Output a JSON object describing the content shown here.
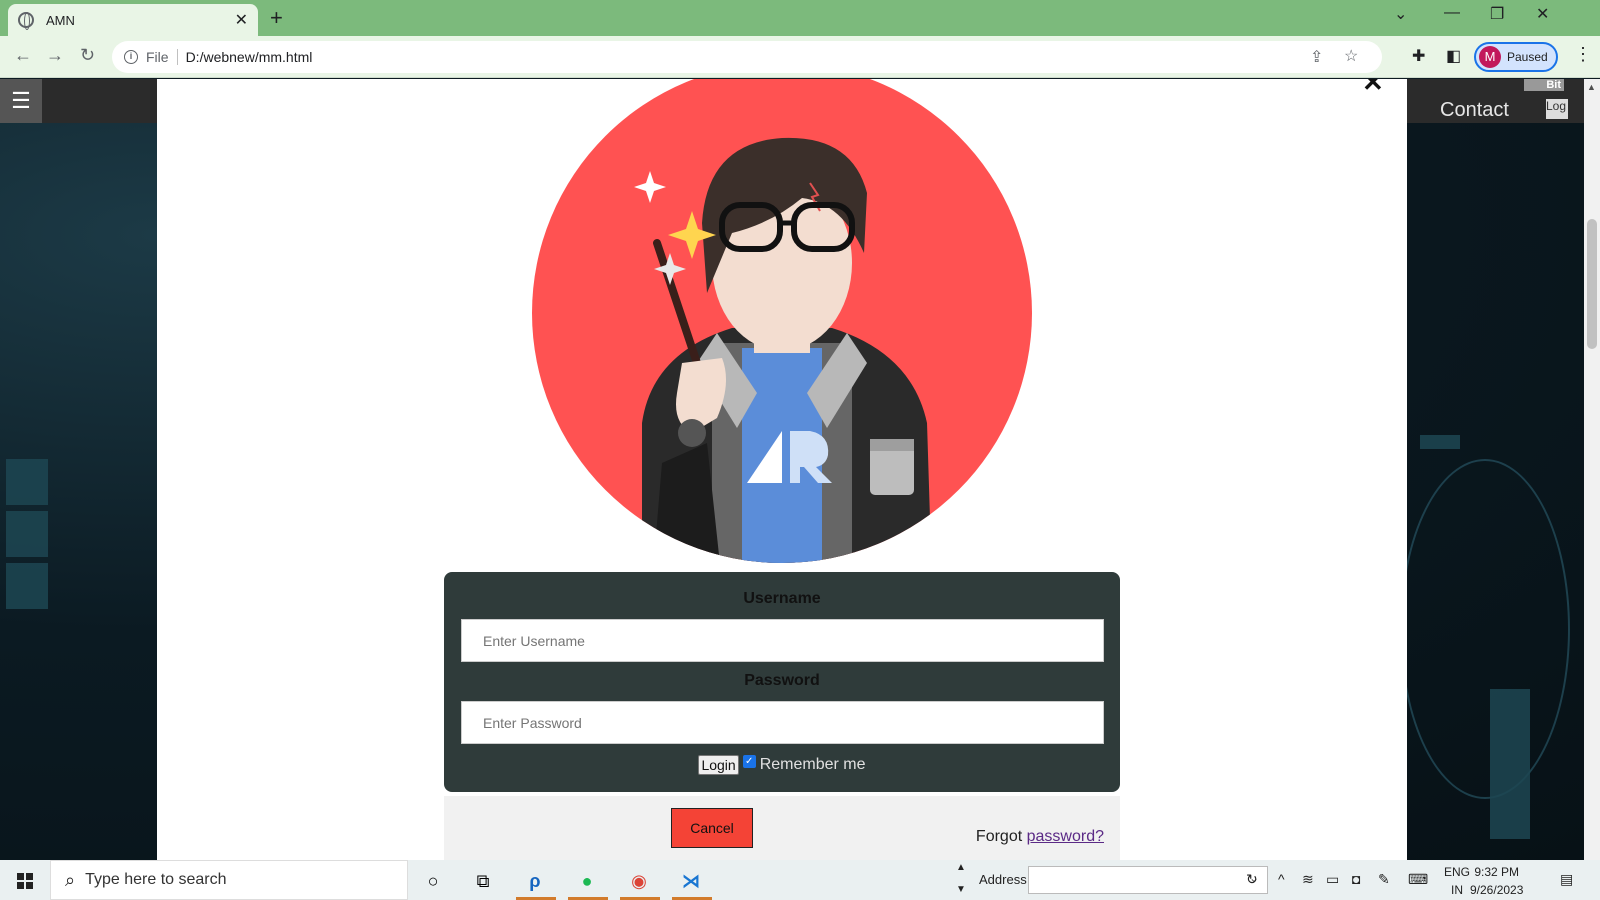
{
  "browser": {
    "tab_title": "AMN",
    "url_scheme": "File",
    "url": "D:/webnew/mm.html",
    "profile_initial": "M",
    "profile_status": "Paused"
  },
  "page": {
    "nav_contact": "Contact",
    "nav_login": "Log",
    "logo_text": "Bit",
    "close_symbol": "✕"
  },
  "login": {
    "username_label": "Username",
    "username_placeholder": "Enter Username",
    "password_label": "Password",
    "password_placeholder": "Enter Password",
    "login_button": "Login",
    "remember_label": "Remember me",
    "remember_checked": true,
    "cancel_button": "Cancel",
    "forgot_prefix": "Forgot",
    "forgot_link": "password?"
  },
  "taskbar": {
    "search_placeholder": "Type here to search",
    "address_label": "Address",
    "lang_top": "ENG",
    "lang_bottom": "IN",
    "time": "9:32 PM",
    "date": "9/26/2023"
  },
  "colors": {
    "avatar_bg": "#ff5252",
    "login_panel": "#2f3b3a",
    "cancel_red": "#f44336",
    "chrome_green": "#7cba7c"
  }
}
